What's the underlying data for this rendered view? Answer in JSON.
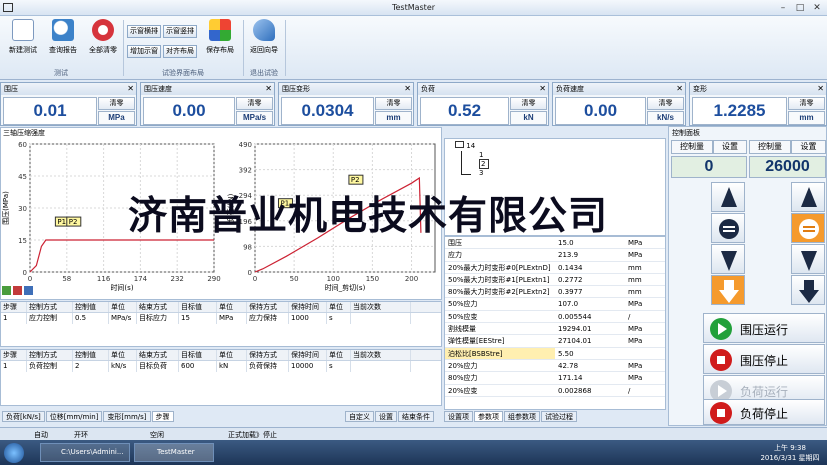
{
  "window": {
    "title": "TestMaster"
  },
  "ribbon": {
    "new_test": "新建测试",
    "view_report": "查询报告",
    "clear_all": "全部清零",
    "group_test": "测试",
    "show_horiz": "示窗横排",
    "show_vert": "示窗竖排",
    "add_window": "增加示窗",
    "align_layout": "对齐布局",
    "save_layout": "保存布局",
    "group_layout": "试验界面布局",
    "back_wizard": "返回向导",
    "group_exit": "退出试验"
  },
  "panels": [
    {
      "title": "围压",
      "value": "0.01",
      "clear": "清零",
      "unit": "MPa"
    },
    {
      "title": "围压速度",
      "value": "0.00",
      "clear": "清零",
      "unit": "MPa/s"
    },
    {
      "title": "围压变形",
      "value": "0.0304",
      "clear": "清零",
      "unit": "mm"
    },
    {
      "title": "负荷",
      "value": "0.52",
      "clear": "清零",
      "unit": "kN"
    },
    {
      "title": "负荷速度",
      "value": "0.00",
      "clear": "清零",
      "unit": "kN/s"
    },
    {
      "title": "变形",
      "value": "1.2285",
      "clear": "清零",
      "unit": "mm"
    }
  ],
  "chart_section": {
    "title": "三轴压缩强度"
  },
  "chart_data": [
    {
      "type": "line",
      "ylabel": "围压(MPa)",
      "xlabel": "时间(s)",
      "xticks": [
        "0",
        "58",
        "116",
        "174",
        "232",
        "290"
      ],
      "yticks": [
        "0",
        "15",
        "30",
        "45",
        "60"
      ],
      "xlim": [
        0,
        290
      ],
      "ylim": [
        0,
        60
      ],
      "series": [
        {
          "x": [
            0,
            10,
            18,
            25,
            35,
            290
          ],
          "y": [
            0,
            3,
            12,
            15,
            15,
            15
          ]
        }
      ],
      "annotations": [
        "P1",
        "P2"
      ]
    },
    {
      "type": "line",
      "ylabel": "负荷(kN)",
      "xlabel": "时间_剪切(s)",
      "xticks": [
        "0",
        "50",
        "100",
        "150",
        "200"
      ],
      "yticks": [
        "0",
        "98",
        "196",
        "294",
        "392",
        "490"
      ],
      "xlim": [
        0,
        230
      ],
      "ylim": [
        0,
        490
      ],
      "series": [
        {
          "x": [
            0,
            10,
            40,
            80,
            120,
            160,
            200,
            210,
            212
          ],
          "y": [
            0,
            12,
            60,
            130,
            205,
            275,
            340,
            360,
            150
          ]
        }
      ],
      "annotations": [
        "P1",
        "P2"
      ]
    }
  ],
  "steps1": {
    "headers": [
      "步骤",
      "控制方式",
      "控制值",
      "单位",
      "结束方式",
      "目标值",
      "单位",
      "保持方式",
      "保持时间",
      "单位",
      "当前次数"
    ],
    "rows": [
      [
        "1",
        "应力控制",
        "0.5",
        "MPa/s",
        "目标应力",
        "15",
        "MPa",
        "应力保持",
        "1000",
        "s",
        ""
      ]
    ]
  },
  "steps2": {
    "headers": [
      "步骤",
      "控制方式",
      "控制值",
      "单位",
      "结束方式",
      "目标值",
      "单位",
      "保持方式",
      "保持时间",
      "单位",
      "当前次数"
    ],
    "rows": [
      [
        "1",
        "负荷控制",
        "2",
        "kN/s",
        "目标负荷",
        "600",
        "kN",
        "负荷保持",
        "10000",
        "s",
        ""
      ]
    ]
  },
  "bottom_tabs": [
    "负荷[kN/s]",
    "位移[mm/min]",
    "变形[mm/s]",
    "步骤"
  ],
  "bottom_btns": [
    "自定义",
    "设置",
    "结束条件"
  ],
  "tree": {
    "root": "14",
    "items": [
      "1",
      "2",
      "3"
    ]
  },
  "params": [
    [
      "围压",
      "15.0",
      "MPa"
    ],
    [
      "应力",
      "213.9",
      "MPa"
    ],
    [
      "20%最大力时变形#0[PLExtnD]",
      "0.1434",
      "mm"
    ],
    [
      "50%最大力时变形#1[PLExtn1]",
      "0.2772",
      "mm"
    ],
    [
      "80%最大力时变形#2[PLExtn2]",
      "0.3977",
      "mm"
    ],
    [
      "50%应力",
      "107.0",
      "MPa"
    ],
    [
      "50%应变",
      "0.005544",
      "/"
    ],
    [
      "割线模量",
      "19294.01",
      "MPa"
    ],
    [
      "弹性模量[EEStre]",
      "27104.01",
      "MPa"
    ],
    [
      "泊松比[BSBStre]",
      "5.50",
      ""
    ],
    [
      "20%应力",
      "42.78",
      "MPa"
    ],
    [
      "80%应力",
      "171.14",
      "MPa"
    ],
    [
      "20%应变",
      "0.002868",
      "/"
    ]
  ],
  "params_tabs": [
    "设置项",
    "参数项",
    "组参数项",
    "试验过程"
  ],
  "control": {
    "title": "控制面板",
    "label1": "控制量",
    "set1": "设置",
    "label2": "控制量",
    "set2": "设置",
    "val1": "0",
    "val2": "26000",
    "run_confining": "围压运行",
    "stop_confining": "围压停止",
    "run_load": "负荷运行",
    "stop_load": "负荷停止"
  },
  "status": {
    "mode": "自动",
    "loop": "开环",
    "state": "空闲",
    "formal": "正式加载》停止"
  },
  "taskbar": {
    "item1": "C:\\Users\\Admini...",
    "item2": "TestMaster",
    "time": "上午 9:38",
    "date": "2016/3/31 星期四"
  },
  "watermark": "济南普业机电技术有限公司",
  "colors": {
    "accent": "#1d4e9e",
    "line_red": "#cc2233",
    "go_green": "#22a03a",
    "stop_red": "#d01b1b"
  }
}
